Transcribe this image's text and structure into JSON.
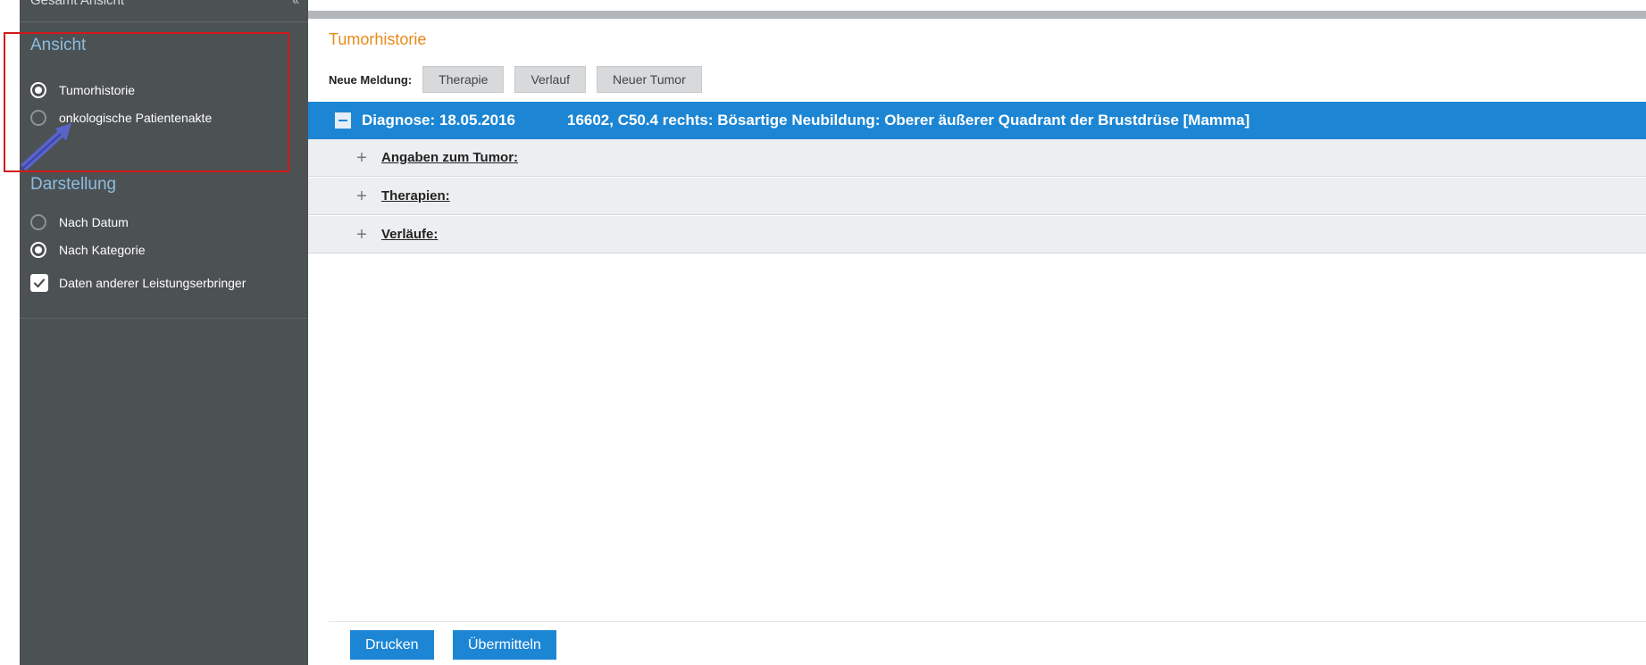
{
  "sidebar": {
    "clipped_top_text": "Gesamt Ansicht",
    "ansicht": {
      "title": "Ansicht",
      "options": [
        {
          "label": "Tumorhistorie",
          "selected": true
        },
        {
          "label": "onkologische Patientenakte",
          "selected": false
        }
      ]
    },
    "darstellung": {
      "title": "Darstellung",
      "options": [
        {
          "label": "Nach Datum",
          "selected": false
        },
        {
          "label": "Nach Kategorie",
          "selected": true
        }
      ],
      "checkbox": {
        "label": "Daten anderer Leistungserbringer",
        "checked": true
      }
    }
  },
  "main": {
    "title": "Tumorhistorie",
    "neue_meldung": {
      "label": "Neue Meldung:",
      "buttons": [
        "Therapie",
        "Verlauf",
        "Neuer Tumor"
      ]
    },
    "diagnosis": {
      "date_label": "Diagnose: 18.05.2016",
      "description": "16602, C50.4 rechts: Bösartige Neubildung: Oberer äußerer Quadrant der Brustdrüse [Mamma]"
    },
    "sections": [
      "Angaben zum Tumor:",
      "Therapien:",
      "Verläufe:"
    ],
    "footer_buttons": {
      "print": "Drucken",
      "submit": "Übermitteln"
    }
  },
  "colors": {
    "sidebar_bg": "#4c5154",
    "accent_blue": "#1d86d4",
    "title_orange": "#e88a1a",
    "section_title_blue": "#8cbde0",
    "highlight_red": "#d11a1a"
  }
}
